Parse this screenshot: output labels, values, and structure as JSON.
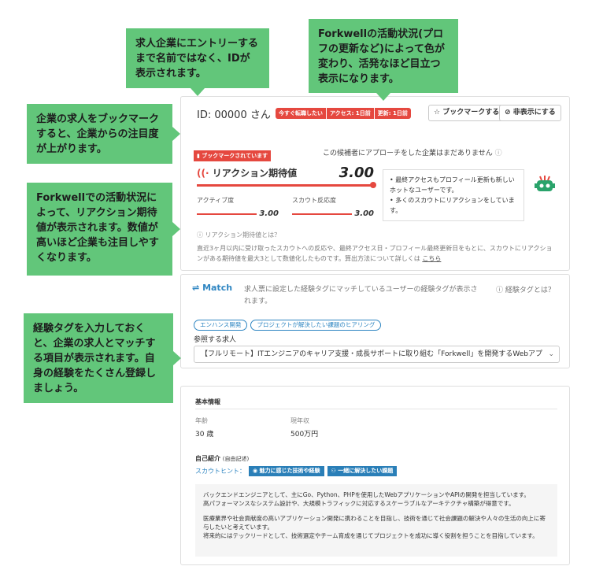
{
  "callouts": {
    "entry": "求人企業にエントリーするまで名前ではなく、IDが表示されます。",
    "activity": "Forkwellの活動状況(プロフの更新など)によって色が変わり、活発なほど目立つ表示になります。",
    "bookmark": "企業の求人をブックマークすると、企業からの注目度が上がります。",
    "reaction": "Forkwellでの活動状況によって、リアクション期待値が表示されます。数値が高いほど企業も注目しやすくなります。",
    "tags": "経験タグを入力しておくと、企業の求人とマッチする項目が表示されます。自身の経験をたくさん登録しましょう。"
  },
  "profile": {
    "id_label": "ID: 00000 さん",
    "badges": [
      "今すぐ転職したい",
      "アクセス: 1日前",
      "更新: 1日前"
    ],
    "bookmark_button": "ブックマークする",
    "hide_button": "非表示にする",
    "bookmarked_tag": "ブックマークされています",
    "approach_text": "この候補者にアプローチをした企業はまだありません",
    "reaction_label": "リアクション期待値",
    "reaction_value": "3.00",
    "activity_label": "アクティブ度",
    "activity_value": "3.00",
    "scout_label": "スカウト反応度",
    "scout_value": "3.00",
    "notes": [
      "最終アクセスもプロフィール更新も新しいホットなユーザーです。",
      "多くのスカウトにリアクションをしています。"
    ],
    "what_is": "リアクション期待値とは？",
    "description": "直近3ヶ月以内に受け取ったスカウトへの反応や、最終アクセス日・プロフィール最終更新日をもとに、スカウトにリアクションがある期待値を最大3として数値化したものです。算出方法について詳しくは",
    "link": "こちら"
  },
  "match": {
    "logo": "Match",
    "description": "求人票に設定した経験タグにマッチしているユーザーの経験タグが表示されます。",
    "what_is": "経験タグとは？",
    "tags": [
      "エンハンス開発",
      "プロジェクトが解決したい課題のヒアリング"
    ],
    "ref_label": "参照する求人",
    "job_select": "【フルリモート】ITエンジニアのキャリア支援・成長サポートに取り組む「Forkwell」を開発するWebアプ"
  },
  "basic": {
    "title": "基本情報",
    "age_label": "年齢",
    "age_value": "30 歳",
    "income_label": "現年収",
    "income_value": "500万円",
    "intro_title": "自己紹介",
    "intro_note": "(自由記述)",
    "hint_label": "スカウトヒント：",
    "hints": [
      "魅力に感じた技術や経験",
      "一緒に解決したい課題"
    ],
    "intro_lines": [
      "バックエンドエンジニアとして、主にGo、Python、PHPを使用したWebアプリケーションやAPIの開発を担当しています。",
      "高パフォーマンスなシステム設計や、大規模トラフィックに対応するスケーラブルなアーキテクチャ構築が得意です。",
      "",
      "医療業界や社会貢献度の高いアプリケーション開発に携わることを目指し、技術を通じて社会課題の解決や人々の生活の向上に寄与したいと考えています。",
      "将来的にはテックリードとして、技術選定やチーム育成を通じてプロジェクトを成功に導く役割を担うことを目指しています。"
    ]
  },
  "colors": {
    "callout": "#62c67a",
    "accent_red": "#e5483f",
    "link_blue": "#2f86c2"
  }
}
